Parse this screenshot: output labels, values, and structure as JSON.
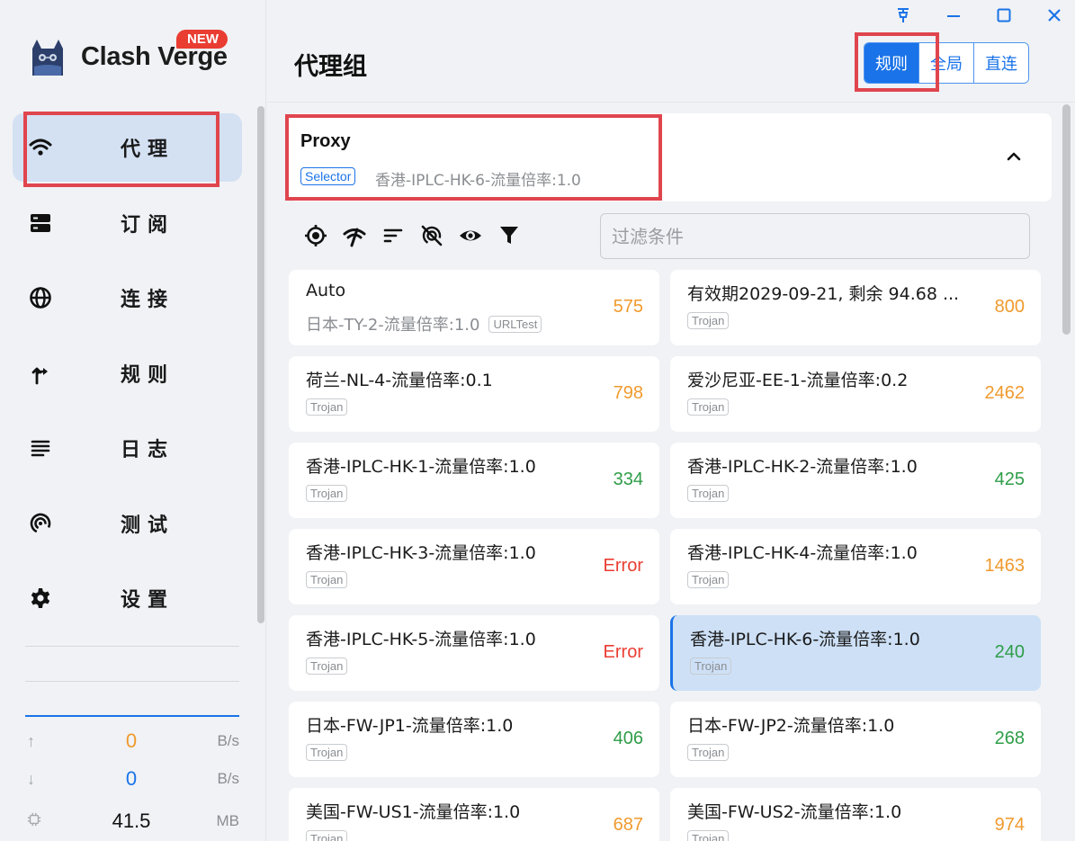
{
  "window": {
    "pin_icon": "pin-icon",
    "minimize_icon": "minimize-icon",
    "maximize_icon": "maximize-icon",
    "close_icon": "close-icon"
  },
  "sidebar": {
    "app_name": "Clash Verge",
    "new_badge": "NEW",
    "items": [
      {
        "label": "代理",
        "icon": "wifi-icon",
        "active": true
      },
      {
        "label": "订阅",
        "icon": "storage-icon"
      },
      {
        "label": "连接",
        "icon": "globe-icon"
      },
      {
        "label": "规则",
        "icon": "fork-icon"
      },
      {
        "label": "日志",
        "icon": "list-icon"
      },
      {
        "label": "测试",
        "icon": "signal-icon"
      },
      {
        "label": "设置",
        "icon": "gear-icon"
      }
    ],
    "traffic": {
      "upload": {
        "value": "0",
        "unit": "B/s",
        "color": "#f09a2e"
      },
      "download": {
        "value": "0",
        "unit": "B/s",
        "color": "#1a73e8"
      },
      "memory": {
        "value": "41.5",
        "unit": "MB"
      }
    }
  },
  "header": {
    "title": "代理组",
    "modes": [
      {
        "label": "规则",
        "active": true
      },
      {
        "label": "全局"
      },
      {
        "label": "直连"
      }
    ]
  },
  "group": {
    "name": "Proxy",
    "type": "Selector",
    "now": "香港-IPLC-HK-6-流量倍率:1.0"
  },
  "toolbar": {
    "icons": [
      "locate-icon",
      "speed-test-icon",
      "sort-icon",
      "hide-unavailable-icon",
      "eye-icon",
      "filter-icon"
    ],
    "filter_placeholder": "过滤条件"
  },
  "proxies": [
    {
      "name": "Auto",
      "now": "日本-TY-2-流量倍率:1.0",
      "tag": "URLTest",
      "delay": "575",
      "status": "orange"
    },
    {
      "name": "有效期2029-09-21, 剩余 94.68 ...",
      "tag": "Trojan",
      "delay": "800",
      "status": "orange"
    },
    {
      "name": "荷兰-NL-4-流量倍率:0.1",
      "tag": "Trojan",
      "delay": "798",
      "status": "orange"
    },
    {
      "name": "爱沙尼亚-EE-1-流量倍率:0.2",
      "tag": "Trojan",
      "delay": "2462",
      "status": "orange"
    },
    {
      "name": "香港-IPLC-HK-1-流量倍率:1.0",
      "tag": "Trojan",
      "delay": "334",
      "status": "green"
    },
    {
      "name": "香港-IPLC-HK-2-流量倍率:1.0",
      "tag": "Trojan",
      "delay": "425",
      "status": "green"
    },
    {
      "name": "香港-IPLC-HK-3-流量倍率:1.0",
      "tag": "Trojan",
      "delay": "Error",
      "status": "red"
    },
    {
      "name": "香港-IPLC-HK-4-流量倍率:1.0",
      "tag": "Trojan",
      "delay": "1463",
      "status": "orange"
    },
    {
      "name": "香港-IPLC-HK-5-流量倍率:1.0",
      "tag": "Trojan",
      "delay": "Error",
      "status": "red"
    },
    {
      "name": "香港-IPLC-HK-6-流量倍率:1.0",
      "tag": "Trojan",
      "delay": "240",
      "status": "green",
      "selected": true
    },
    {
      "name": "日本-FW-JP1-流量倍率:1.0",
      "tag": "Trojan",
      "delay": "406",
      "status": "green"
    },
    {
      "name": "日本-FW-JP2-流量倍率:1.0",
      "tag": "Trojan",
      "delay": "268",
      "status": "green"
    },
    {
      "name": "美国-FW-US1-流量倍率:1.0",
      "tag": "Trojan",
      "delay": "687",
      "status": "orange"
    },
    {
      "name": "美国-FW-US2-流量倍率:1.0",
      "tag": "Trojan",
      "delay": "974",
      "status": "orange"
    }
  ],
  "colors": {
    "accent": "#1a73e8",
    "highlight_box": "#e0454e",
    "delay_good": "#2e9d48",
    "delay_slow": "#f09a2e",
    "delay_error": "#ea3d32"
  }
}
